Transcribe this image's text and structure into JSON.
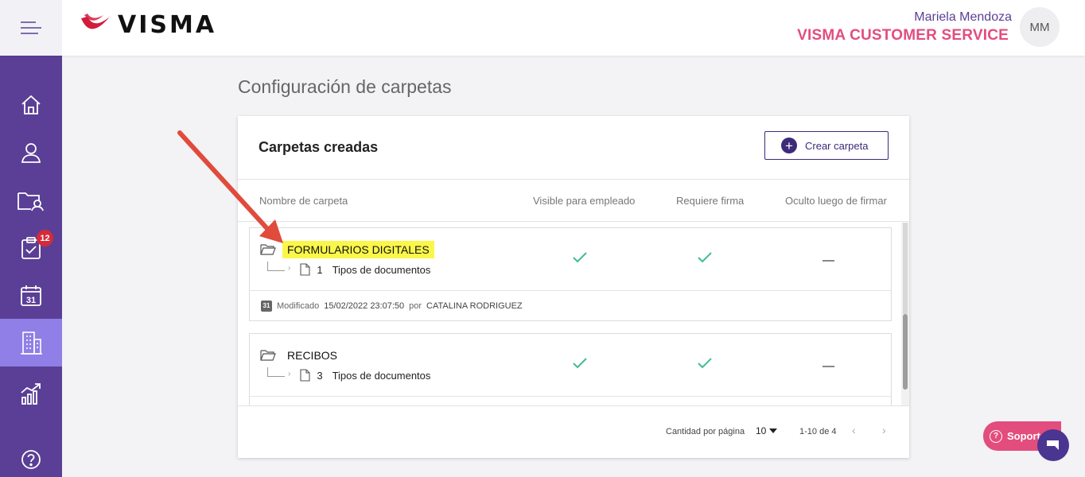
{
  "brand": {
    "logo_text": "VISMA",
    "logo_color": "#d31b3b"
  },
  "user": {
    "name": "Mariela Mendoza",
    "company": "VISMA CUSTOMER SERVICE",
    "initials": "MM"
  },
  "sidebar": {
    "items": [
      {
        "icon": "home-icon"
      },
      {
        "icon": "user-icon"
      },
      {
        "icon": "folder-user-icon"
      },
      {
        "icon": "clipboard-check-icon",
        "badge": "12"
      },
      {
        "icon": "calendar-icon",
        "label": "31"
      },
      {
        "icon": "building-icon",
        "active": true
      },
      {
        "icon": "chart-up-icon"
      },
      {
        "icon": "help-icon"
      }
    ]
  },
  "page": {
    "title": "Configuración de carpetas"
  },
  "card": {
    "title": "Carpetas creadas",
    "create_button": "Crear carpeta",
    "plus_symbol": "+",
    "columns": {
      "name": "Nombre de carpeta",
      "visible": "Visible para empleado",
      "signature": "Requiere firma",
      "hidden": "Oculto luego de firmar"
    },
    "folders": [
      {
        "name": "FORMULARIOS DIGITALES",
        "doc_count": "1",
        "doc_label": "Tipos de documentos",
        "visible": true,
        "requires_signature": true,
        "hidden_after_sign": false,
        "modified_label": "Modificado",
        "modified_date": "15/02/2022 23:07:50",
        "by_label": "por",
        "modified_by": "CATALINA RODRIGUEZ",
        "calendar_day": "31"
      },
      {
        "name": "RECIBOS",
        "doc_count": "3",
        "doc_label": "Tipos de documentos",
        "visible": true,
        "requires_signature": true,
        "hidden_after_sign": false
      }
    ],
    "pagination": {
      "per_page_label": "Cantidad por página",
      "per_page_value": "10",
      "range": "1-10 de 4",
      "prev_symbol": "‹",
      "next_symbol": "›"
    }
  },
  "support": {
    "label": "Soporte",
    "q": "?"
  },
  "colors": {
    "sidebar": "#5b3f96",
    "active_nav": "#8f7fe6",
    "accent_pink": "#e34d7e",
    "check_green": "#3fbd8e",
    "highlight": "#fbf74a",
    "annotation_arrow": "#e04b3c"
  }
}
